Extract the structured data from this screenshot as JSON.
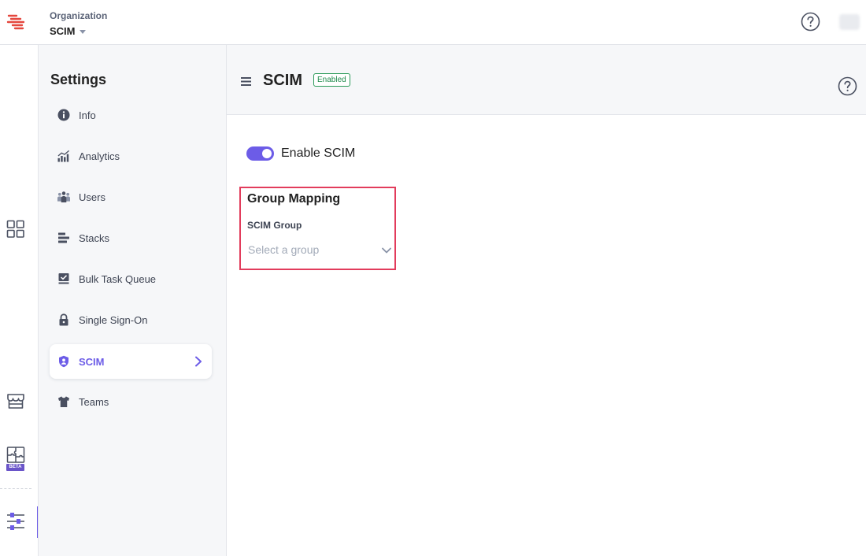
{
  "org": {
    "label": "Organization",
    "name": "SCIM"
  },
  "rail": {
    "items": [
      {
        "name": "apps-grid-icon"
      },
      {
        "name": "marketplace-icon"
      },
      {
        "name": "puzzle-icon",
        "badge": "BETA"
      },
      {
        "name": "settings-sliders-icon",
        "active": true
      }
    ]
  },
  "sidebar": {
    "title": "Settings",
    "items": [
      {
        "label": "Info",
        "icon": "info-icon"
      },
      {
        "label": "Analytics",
        "icon": "analytics-icon"
      },
      {
        "label": "Users",
        "icon": "users-icon"
      },
      {
        "label": "Stacks",
        "icon": "stacks-icon"
      },
      {
        "label": "Bulk Task Queue",
        "icon": "bulk-task-queue-icon"
      },
      {
        "label": "Single Sign-On",
        "icon": "lock-icon"
      },
      {
        "label": "SCIM",
        "icon": "shield-user-icon",
        "active": true
      },
      {
        "label": "Teams",
        "icon": "shirt-icon"
      }
    ]
  },
  "main": {
    "title": "SCIM",
    "status": "Enabled",
    "enable_label": "Enable SCIM",
    "enable_on": true,
    "group_mapping": {
      "title": "Group Mapping",
      "field_label": "SCIM Group",
      "placeholder": "Select a group"
    }
  },
  "colors": {
    "accent": "#6c5ce7",
    "status_green": "#1f8a4c",
    "highlight_red": "#e23c5c",
    "logo_red": "#e5483f"
  }
}
